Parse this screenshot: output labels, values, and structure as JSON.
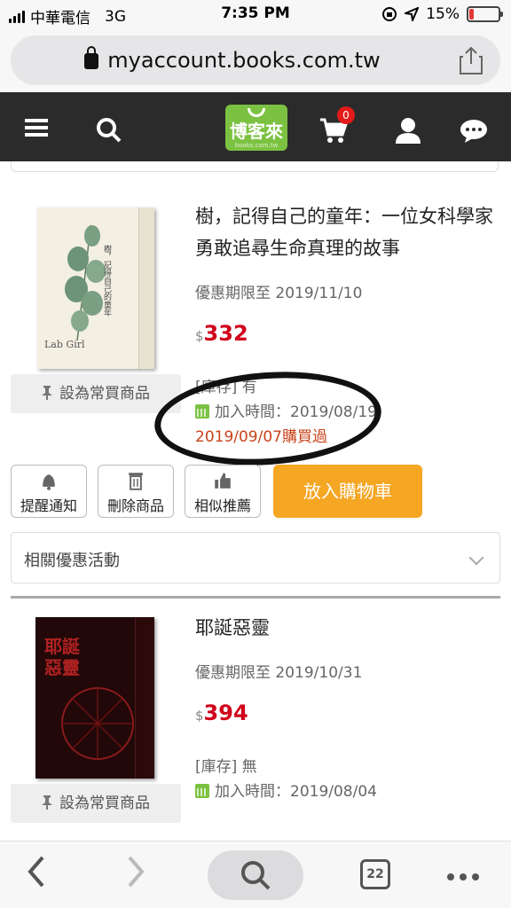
{
  "status_bar": {
    "carrier": "中華電信",
    "network": "3G",
    "time": "7:35 PM",
    "battery": "15%",
    "battery_level": 0.15
  },
  "browser": {
    "url": "myaccount.books.com.tw",
    "tab_count": "22"
  },
  "site_header": {
    "logo_text": "博客來",
    "logo_subtext": "books.com.tw",
    "cart_count": "0",
    "icons": [
      "menu-icon",
      "search-icon",
      "cart-icon",
      "user-icon",
      "chat-icon"
    ]
  },
  "products": [
    {
      "title": "樹，記得自己的童年：一位女科學家勇敢追尋生命真理的故事",
      "promo_deadline": "優惠期限至 2019/11/10",
      "currency": "$",
      "price": "332",
      "stock": "[庫存] 有",
      "added": "加入時間：2019/08/19",
      "purchased": "2019/09/07購買過",
      "favorite_label": "設為常買商品"
    },
    {
      "title": "耶誕惡靈",
      "promo_deadline": "優惠期限至 2019/10/31",
      "currency": "$",
      "price": "394",
      "stock": "[庫存] 無",
      "added": "加入時間：2019/08/04",
      "favorite_label": "設為常買商品"
    }
  ],
  "actions": {
    "notify": "提醒通知",
    "delete": "刪除商品",
    "similar": "相似推薦",
    "add_to_cart": "放入購物車"
  },
  "related_promotions": "相關優惠活動",
  "colors": {
    "accent_green": "#7cc242",
    "price_red": "#d0021b",
    "cart_orange": "#f5a623",
    "header_dark": "#2b2b2b"
  }
}
